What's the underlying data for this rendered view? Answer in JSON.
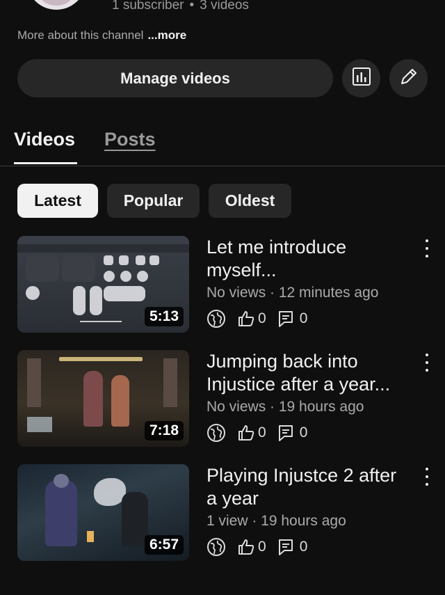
{
  "channel": {
    "subscribers": "1 subscriber",
    "separator": "•",
    "videos_count": "3 videos",
    "about_text": "More about this channel",
    "more_label": "...more"
  },
  "actions": {
    "manage_videos": "Manage videos",
    "analytics_icon": "analytics-chart-icon",
    "edit_icon": "pencil-icon"
  },
  "tabs": [
    {
      "label": "Videos",
      "active": true
    },
    {
      "label": "Posts",
      "active": false
    }
  ],
  "filters": [
    {
      "label": "Latest",
      "active": true
    },
    {
      "label": "Popular",
      "active": false
    },
    {
      "label": "Oldest",
      "active": false
    }
  ],
  "videos": [
    {
      "title_line1": "Let me introduce",
      "title_line2": "myself...",
      "meta": "No views · 12 minutes ago",
      "duration": "5:13",
      "likes": "0",
      "comments": "0"
    },
    {
      "title_line1": "Jumping back into",
      "title_line2": "Injustice after a year...",
      "meta": "No views · 19 hours ago",
      "duration": "7:18",
      "likes": "0",
      "comments": "0"
    },
    {
      "title_line1": "Playing Injustce 2 after",
      "title_line2": "a year",
      "meta": "1 view · 19 hours ago",
      "duration": "6:57",
      "likes": "0",
      "comments": "0"
    }
  ],
  "colors": {
    "background": "#0f0f0f",
    "surface": "#272727",
    "text_primary": "#f1f1f1",
    "text_secondary": "#aaaaaa"
  }
}
